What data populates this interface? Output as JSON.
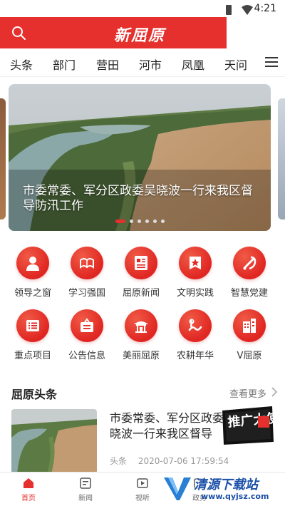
{
  "status_bar": {
    "time": "4:21"
  },
  "header": {
    "logo": "新屈原"
  },
  "tabs": [
    {
      "label": "头条"
    },
    {
      "label": "部门"
    },
    {
      "label": "营田"
    },
    {
      "label": "河市"
    },
    {
      "label": "凤凰"
    },
    {
      "label": "天问"
    }
  ],
  "banner": {
    "title": "市委常委、军分区政委吴晓波一行来我区督导防汛工作",
    "slide_count": 6,
    "active_slide": 1
  },
  "grid": [
    {
      "label": "领导之窗",
      "icon": "person-icon"
    },
    {
      "label": "学习强国",
      "icon": "study-icon"
    },
    {
      "label": "屈原新闻",
      "icon": "news-icon"
    },
    {
      "label": "文明实践",
      "icon": "star-icon"
    },
    {
      "label": "智慧党建",
      "icon": "party-emblem-icon"
    },
    {
      "label": "重点项目",
      "icon": "list-icon"
    },
    {
      "label": "公告信息",
      "icon": "notice-icon"
    },
    {
      "label": "美丽屈原",
      "icon": "pavilion-icon"
    },
    {
      "label": "农耕年华",
      "icon": "dragon-icon"
    },
    {
      "label": "V屈原",
      "icon": "building-icon"
    }
  ],
  "section": {
    "title": "屈原头条",
    "more": "查看更多"
  },
  "news": {
    "headline": "市委常委、军分区政委吴晓波一行来我区督导",
    "category": "头条",
    "timestamp": "2020-07-06 17:59:54"
  },
  "stamp_text": "推广大使",
  "bottom_nav": [
    {
      "label": "首页",
      "icon": "home-icon"
    },
    {
      "label": "新闻",
      "icon": "news-icon"
    },
    {
      "label": "视听",
      "icon": "video-icon"
    },
    {
      "label": "政务",
      "icon": "gov-icon"
    }
  ],
  "watermark": {
    "text": "清源下载站",
    "url": "www.qyjsz.com"
  },
  "colors": {
    "brand_red": "#e5302e",
    "text_dark": "#222222",
    "meta_gray": "#999999"
  }
}
